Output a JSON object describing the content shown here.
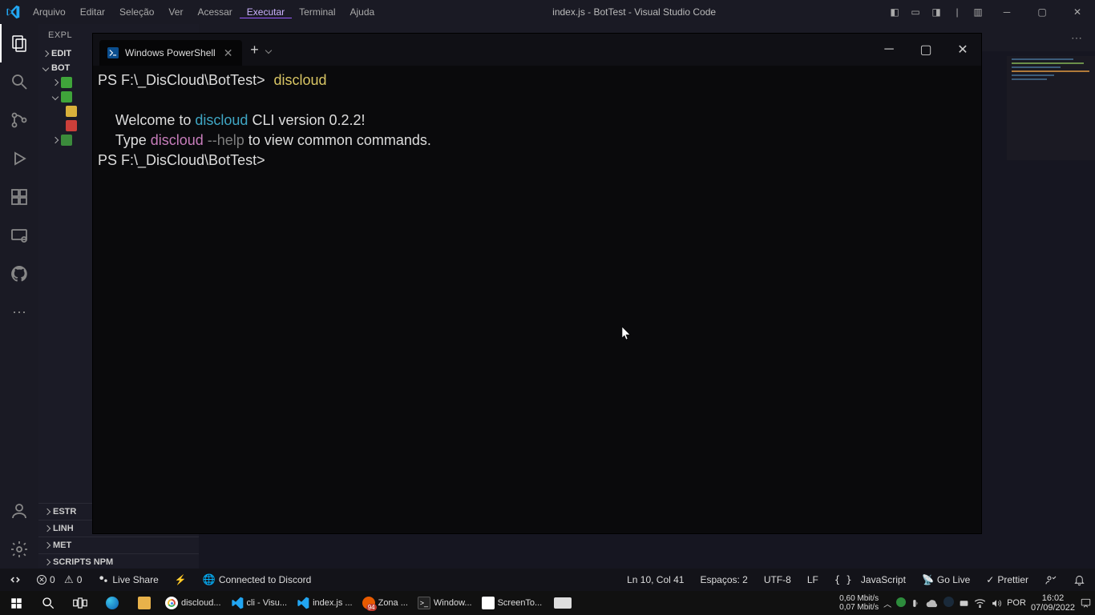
{
  "title_bar": {
    "menus": [
      "Arquivo",
      "Editar",
      "Seleção",
      "Ver",
      "Acessar",
      "Executar",
      "Terminal",
      "Ajuda"
    ],
    "active_menu_index": 5,
    "title": "index.js - BotTest - Visual Studio Code"
  },
  "sidebar": {
    "header": "EXPL",
    "sections": {
      "editors": "EDIT",
      "project": "BOT",
      "bottom": [
        "ESTR",
        "LINH",
        "MET",
        "SCRIPTS NPM"
      ]
    }
  },
  "status_bar": {
    "errors": "0",
    "warns": "0",
    "liveshare": "Live Share",
    "discord": "Connected to Discord",
    "pos": "Ln 10, Col 41",
    "spaces": "Espaços: 2",
    "enc": "UTF-8",
    "eol": "LF",
    "lang": "JavaScript",
    "golive": "Go Live",
    "prettier": "Prettier"
  },
  "terminal": {
    "tab_title": "Windows PowerShell",
    "prompt_path": "PS F:\\_DisCloud\\BotTest>",
    "cmd": "discloud",
    "welcome_pre": "Welcome to ",
    "welcome_name": "discloud",
    "welcome_post": " CLI version 0.2.2!",
    "type_pre": "Type ",
    "type_cmd": "discloud",
    "type_flag": " --help",
    "type_post": " to view common commands."
  },
  "taskbar": {
    "apps": [
      {
        "label": "discloud...",
        "color": "#fff",
        "round": true
      },
      {
        "label": "cli - Visu...",
        "color": "#22a6f2"
      },
      {
        "label": "index.js ...",
        "color": "#22a6f2"
      },
      {
        "label": "Zona ...",
        "color": "#e85b00",
        "round": true,
        "badge": "94"
      },
      {
        "label": "Window...",
        "color": "#222",
        "term": true
      },
      {
        "label": "ScreenTo...",
        "color": "#fff"
      }
    ],
    "net_down": "0,60 Mbit/s",
    "net_up": "0,07 Mbit/s",
    "lang": "POR",
    "time": "16:02",
    "date": "07/09/2022"
  }
}
